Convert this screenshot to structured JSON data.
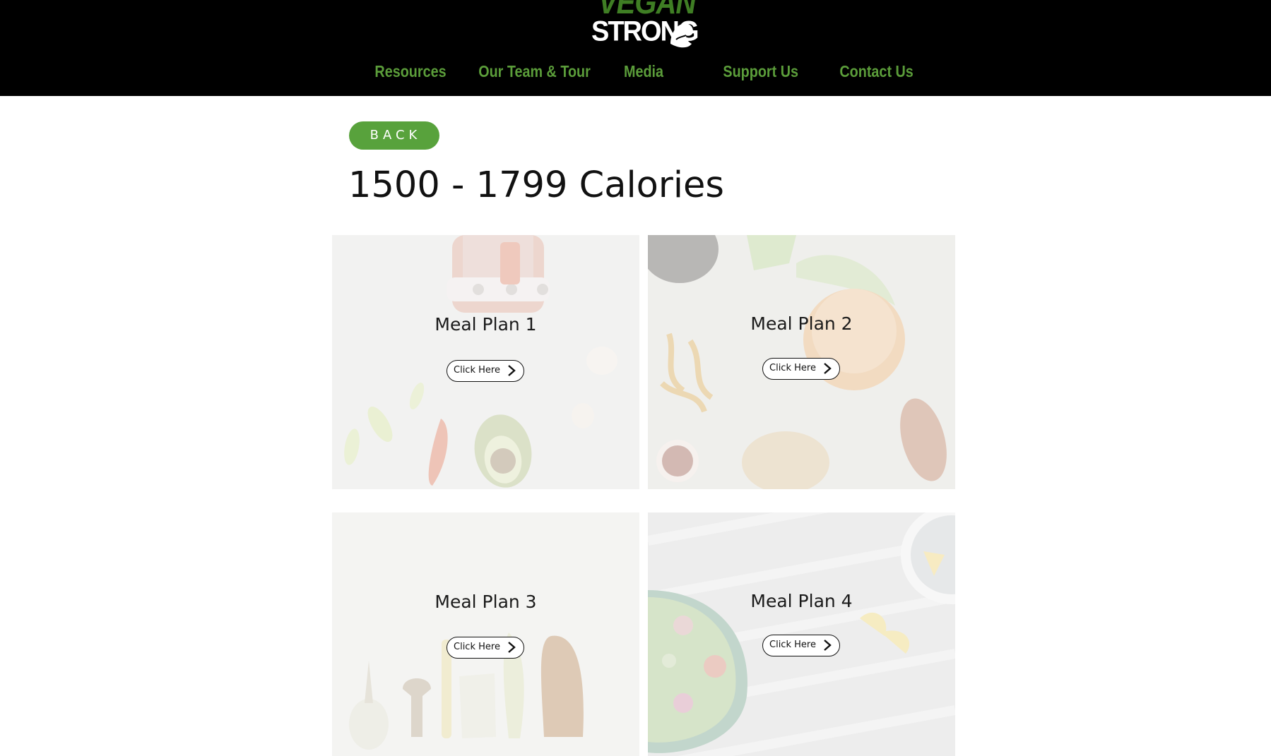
{
  "brand": {
    "logo_top": "VEGAN",
    "logo_bottom": "STRONG",
    "colors": {
      "green": "#5b9d3a",
      "header_bg": "#000000"
    }
  },
  "nav": {
    "items": [
      {
        "label": "Resources"
      },
      {
        "label": "Our Team & Tour"
      },
      {
        "label": "Media"
      },
      {
        "label": "Support Us"
      },
      {
        "label": "Contact Us"
      }
    ]
  },
  "back_button": {
    "label": "BACK"
  },
  "page_title": "1500 - 1799 Calories",
  "cards": [
    {
      "title": "Meal Plan 1",
      "button_label": "Click Here",
      "button_icon": "chevron-right-icon"
    },
    {
      "title": "Meal Plan 2",
      "button_label": "Click Here",
      "button_icon": "chevron-right-icon"
    },
    {
      "title": "Meal Plan 3",
      "button_label": "Click Here",
      "button_icon": "chevron-right-icon"
    },
    {
      "title": "Meal Plan 4",
      "button_label": "Click Here",
      "button_icon": "chevron-right-icon"
    }
  ]
}
